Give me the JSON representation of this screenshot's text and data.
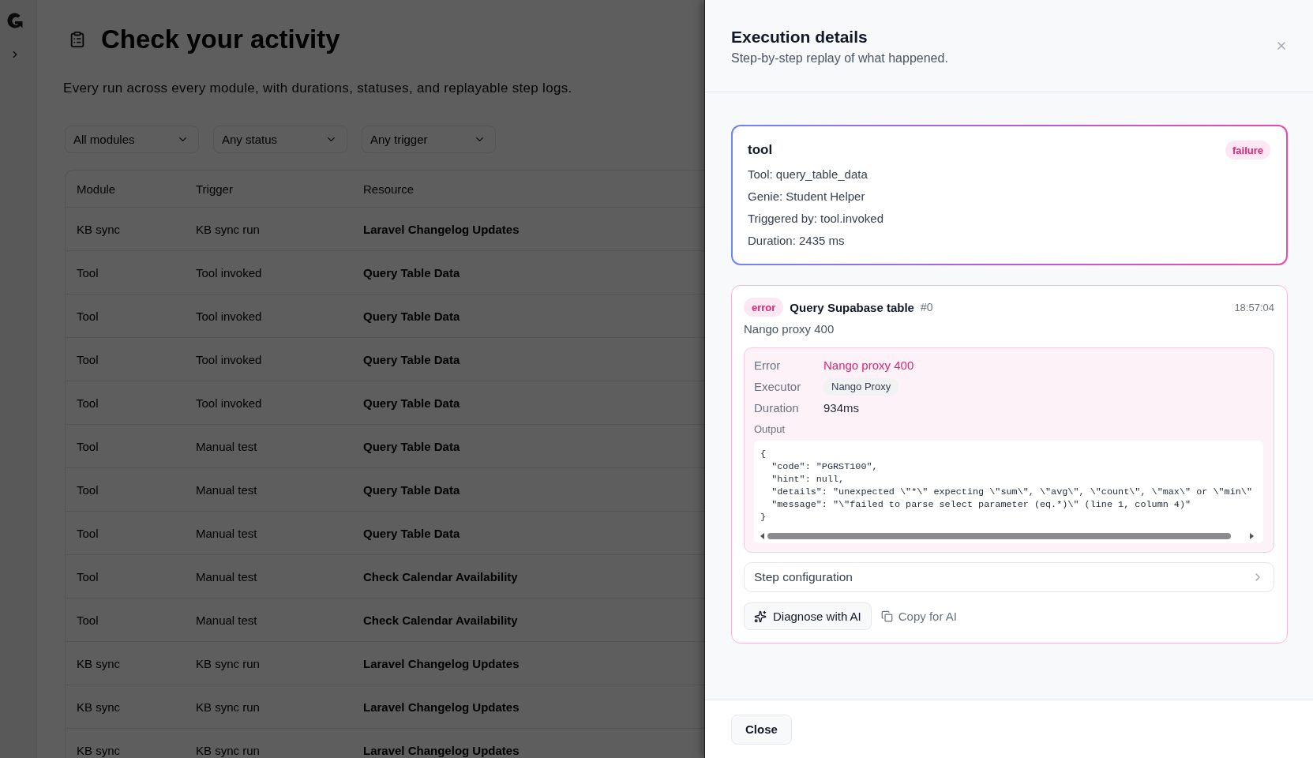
{
  "page": {
    "title": "Check your activity",
    "subtitle": "Every run across every module, with durations, statuses, and replayable step logs."
  },
  "filters": [
    "All modules",
    "Any status",
    "Any trigger"
  ],
  "table": {
    "columns": [
      "Module",
      "Trigger",
      "Resource"
    ],
    "rows": [
      [
        "KB sync",
        "KB sync run",
        "Laravel Changelog Updates"
      ],
      [
        "Tool",
        "Tool invoked",
        "Query Table Data"
      ],
      [
        "Tool",
        "Tool invoked",
        "Query Table Data"
      ],
      [
        "Tool",
        "Tool invoked",
        "Query Table Data"
      ],
      [
        "Tool",
        "Tool invoked",
        "Query Table Data"
      ],
      [
        "Tool",
        "Manual test",
        "Query Table Data"
      ],
      [
        "Tool",
        "Manual test",
        "Query Table Data"
      ],
      [
        "Tool",
        "Manual test",
        "Query Table Data"
      ],
      [
        "Tool",
        "Manual test",
        "Check Calendar Availability"
      ],
      [
        "Tool",
        "Manual test",
        "Check Calendar Availability"
      ],
      [
        "KB sync",
        "KB sync run",
        "Laravel Changelog Updates"
      ],
      [
        "KB sync",
        "KB sync run",
        "Laravel Changelog Updates"
      ],
      [
        "KB sync",
        "KB sync run",
        "Laravel Changelog Updates"
      ]
    ]
  },
  "panel": {
    "title": "Execution details",
    "subtitle": "Step-by-step replay of what happened.",
    "summary": {
      "title": "tool",
      "status": "failure",
      "lines": [
        "Tool: query_table_data",
        "Genie: Student Helper",
        "Triggered by: tool.invoked",
        "Duration: 2435 ms"
      ]
    },
    "steps": [
      {
        "status": "error",
        "name": "Query Supabase table",
        "index": "#0",
        "time": "18:57:04",
        "message": "Nango proxy 400",
        "details": [
          {
            "kind": "error",
            "label": "Error",
            "value": "Nango proxy 400"
          },
          {
            "kind": "chip",
            "label": "Executor",
            "value": "Nango Proxy"
          },
          {
            "kind": "text",
            "label": "Duration",
            "value": "934ms"
          }
        ],
        "output_label": "Output",
        "output": "{\n  \"code\": \"PGRST100\",\n  \"hint\": null,\n  \"details\": \"unexpected \\\"*\\\" expecting \\\"sum\\\", \\\"avg\\\", \\\"count\\\", \\\"max\\\" or \\\"min\\\"\n  \"message\": \"\\\"failed to parse select parameter (eq.*)\\\" (line 1, column 4)\"\n}",
        "config": {
          "label": "Step configuration",
          "expanded": false
        },
        "actions": [
          {
            "kind": "diagnose",
            "label": "Diagnose with AI"
          },
          {
            "kind": "copy",
            "label": "Copy for AI"
          }
        ]
      }
    ],
    "close_button": "Close"
  }
}
